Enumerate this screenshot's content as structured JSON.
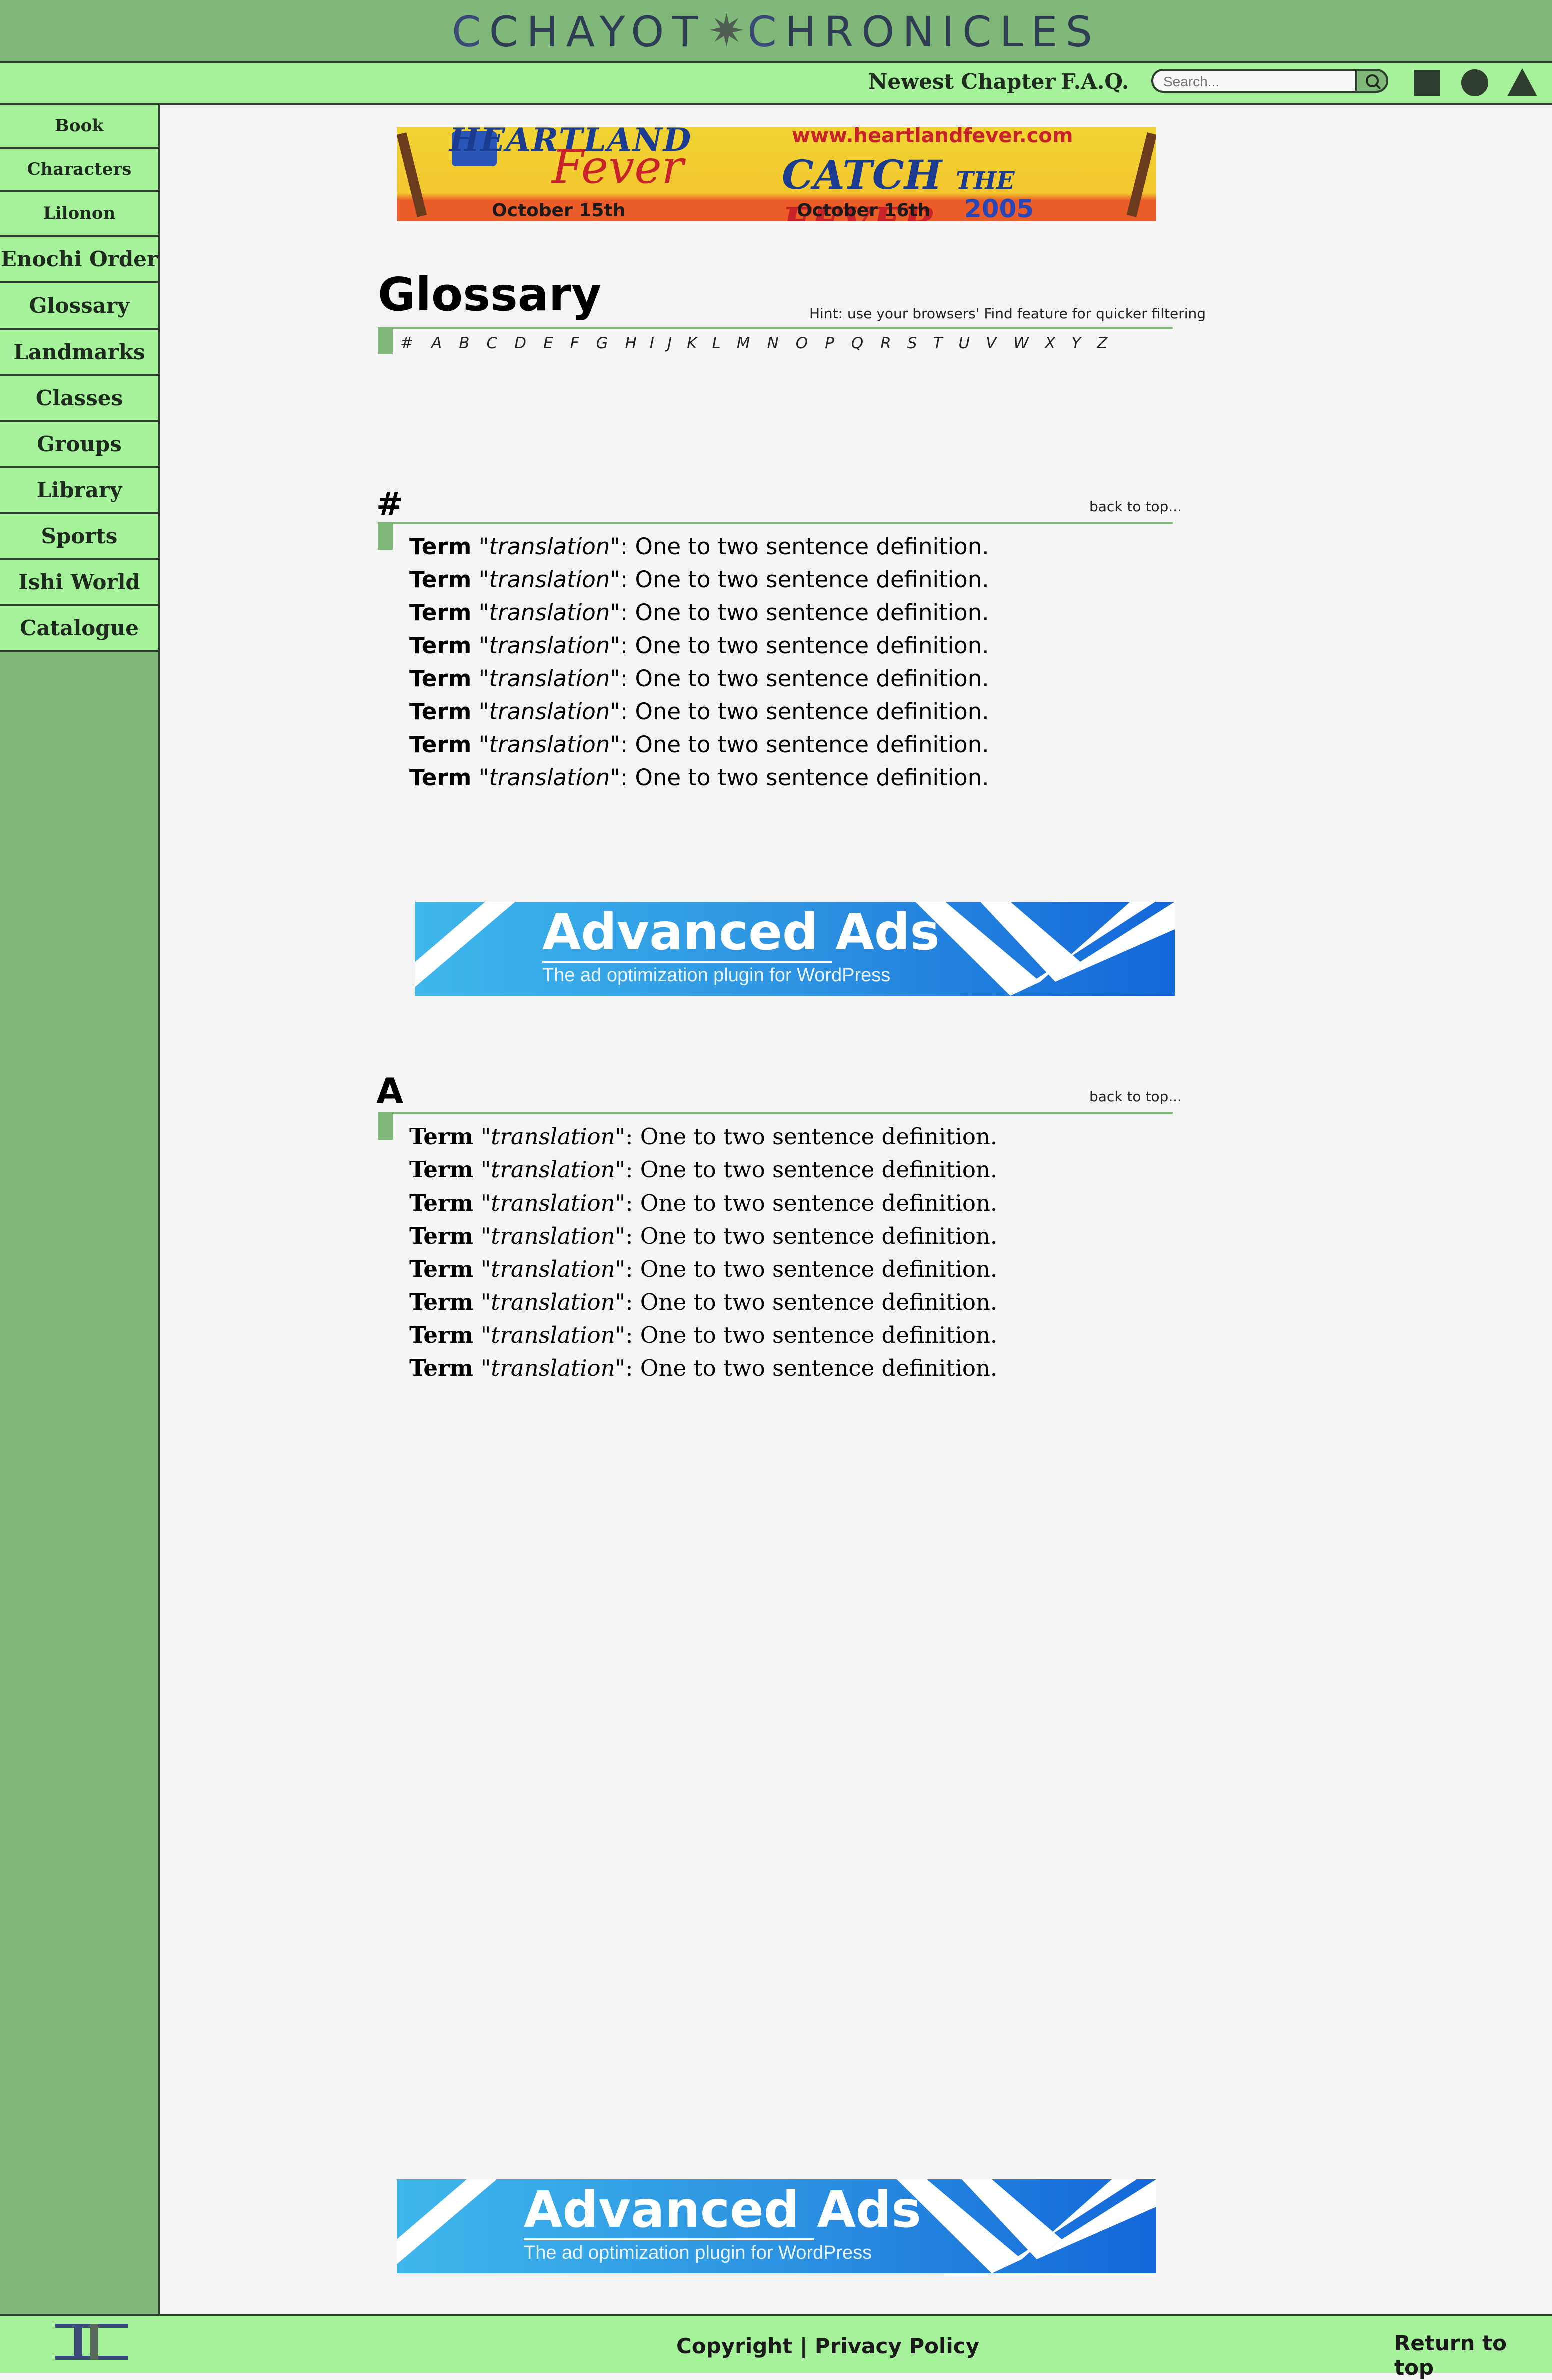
{
  "site": {
    "logo_left": "CHAYOT",
    "logo_right": "HRONICLES",
    "logo_c": "C",
    "logo_star": "✷"
  },
  "navbar": {
    "newest_chapter": "Newest Chapter",
    "faq": "F.A.Q.",
    "search_placeholder": "Search..."
  },
  "sidebar": {
    "items": [
      {
        "label": "Book"
      },
      {
        "label": "Characters"
      },
      {
        "label": "Lilonon"
      },
      {
        "label": "Enochi Order"
      },
      {
        "label": "Glossary"
      },
      {
        "label": "Landmarks"
      },
      {
        "label": "Classes"
      },
      {
        "label": "Groups"
      },
      {
        "label": "Library"
      },
      {
        "label": "Sports"
      },
      {
        "label": "Ishi World"
      },
      {
        "label": "Catalogue"
      }
    ]
  },
  "ad_top": {
    "headline": "HEARTLAND",
    "script": "Fever",
    "url": "www.heartlandfever.com",
    "catch_a": "CATCH",
    "catch_the": "THE",
    "catch_b": "FEVER",
    "date1": "October 15th",
    "date2": "October 16th",
    "year": "2005"
  },
  "page": {
    "title": "Glossary",
    "hint": "Hint: use your browsers' Find feature for quicker filtering",
    "letters": [
      "#",
      "A",
      "B",
      "C",
      "D",
      "E",
      "F",
      "G",
      "H",
      "I",
      "J",
      "K",
      "L",
      "M",
      "N",
      "O",
      "P",
      "Q",
      "R",
      "S",
      "T",
      "U",
      "V",
      "W",
      "X",
      "Y",
      "Z"
    ]
  },
  "sections": [
    {
      "heading": "#",
      "back": "back to top...",
      "entries": [
        {
          "term": "Term",
          "translation": "\"translation\"",
          "definition": ": One to two sentence definition."
        },
        {
          "term": "Term",
          "translation": "\"translation\"",
          "definition": ": One to two sentence definition."
        },
        {
          "term": "Term",
          "translation": "\"translation\"",
          "definition": ": One to two sentence definition."
        },
        {
          "term": "Term",
          "translation": "\"translation\"",
          "definition": ": One to two sentence definition."
        },
        {
          "term": "Term",
          "translation": "\"translation\"",
          "definition": ": One to two sentence definition."
        },
        {
          "term": "Term",
          "translation": "\"translation\"",
          "definition": ": One to two sentence definition."
        },
        {
          "term": "Term",
          "translation": "\"translation\"",
          "definition": ": One to two sentence definition."
        },
        {
          "term": "Term",
          "translation": "\"translation\"",
          "definition": ": One to two sentence definition."
        }
      ]
    },
    {
      "heading": "A",
      "back": "back to top...",
      "entries": [
        {
          "term": "Term",
          "translation": "\"translation\"",
          "definition": ": One to two sentence definition."
        },
        {
          "term": "Term",
          "translation": "\"translation\"",
          "definition": ": One to two sentence definition."
        },
        {
          "term": "Term",
          "translation": "\"translation\"",
          "definition": ": One to two sentence definition."
        },
        {
          "term": "Term",
          "translation": "\"translation\"",
          "definition": ": One to two sentence definition."
        },
        {
          "term": "Term",
          "translation": "\"translation\"",
          "definition": ": One to two sentence definition."
        },
        {
          "term": "Term",
          "translation": "\"translation\"",
          "definition": ": One to two sentence definition."
        },
        {
          "term": "Term",
          "translation": "\"translation\"",
          "definition": ": One to two sentence definition."
        },
        {
          "term": "Term",
          "translation": "\"translation\"",
          "definition": ": One to two sentence definition."
        }
      ]
    }
  ],
  "ads": {
    "advanced_title": "Advanced Ads",
    "advanced_sub": "The ad optimization plugin for WordPress"
  },
  "footer": {
    "copyright": "Copyright | Privacy Policy",
    "return": "Return to top"
  },
  "colors": {
    "banner": "#80b87a",
    "nav_light": "#a6f29a",
    "dark": "#2f3d2f",
    "page_bg": "#f4f4f4"
  },
  "icons": [
    "search-icon",
    "square-icon",
    "circle-icon",
    "triangle-icon",
    "site-logo-icon"
  ]
}
